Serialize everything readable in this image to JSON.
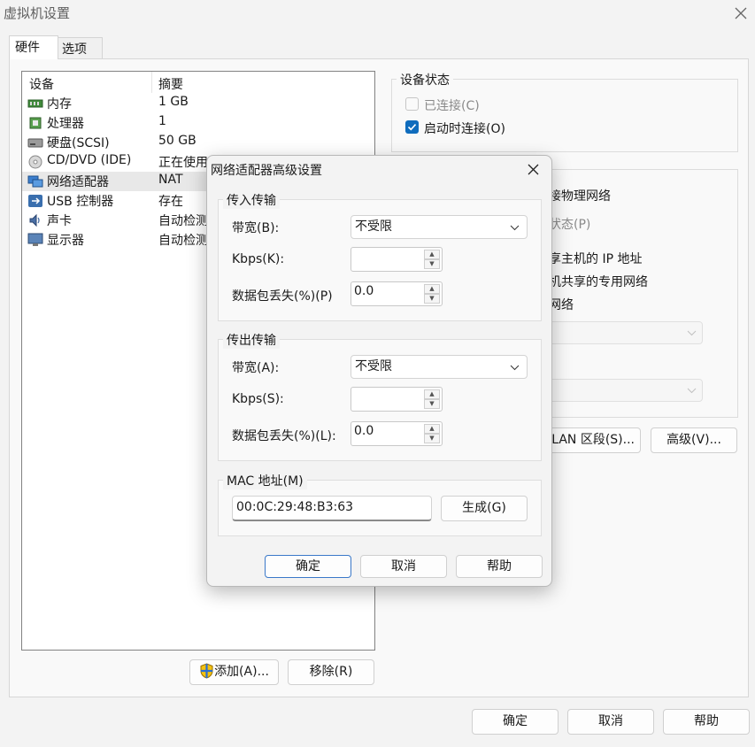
{
  "window": {
    "title": "虚拟机设置"
  },
  "tabs": [
    {
      "label": "硬件"
    },
    {
      "label": "选项"
    }
  ],
  "device_list": {
    "headers": {
      "device": "设备",
      "summary": "摘要"
    },
    "rows": [
      {
        "name": "内存",
        "summary": "1 GB",
        "icon": "memory-icon"
      },
      {
        "name": "处理器",
        "summary": "1",
        "icon": "cpu-icon"
      },
      {
        "name": "硬盘(SCSI)",
        "summary": "50 GB",
        "icon": "hard-disk-icon"
      },
      {
        "name": "CD/DVD (IDE)",
        "summary": "正在使用",
        "icon": "cd-dvd-icon"
      },
      {
        "name": "网络适配器",
        "summary": "NAT",
        "icon": "network-adapter-icon"
      },
      {
        "name": "USB 控制器",
        "summary": "存在",
        "icon": "usb-icon"
      },
      {
        "name": "声卡",
        "summary": "自动检测",
        "icon": "sound-icon"
      },
      {
        "name": "显示器",
        "summary": "自动检测",
        "icon": "monitor-icon"
      }
    ]
  },
  "device_buttons": {
    "add": "添加(A)...",
    "remove": "移除(R)"
  },
  "device_status": {
    "title": "设备状态",
    "connected": "已连接(C)",
    "connect_on_power": "启动时连接(O)"
  },
  "network_partial": {
    "bridged": "接物理网络",
    "replicate": "状态(P)",
    "nat": "享主机的 IP 地址",
    "host_only": "机共享的专用网络",
    "custom": "网络",
    "lan_segment_btn": "LAN 区段(S)...",
    "advanced_btn": "高级(V)..."
  },
  "bottom_buttons": {
    "ok": "确定",
    "cancel": "取消",
    "help": "帮助"
  },
  "dialog": {
    "title": "网络适配器高级设置",
    "incoming": {
      "title": "传入传输",
      "bandwidth_label": "带宽(B):",
      "bandwidth_value": "不受限",
      "kbps_label": "Kbps(K):",
      "kbps_value": "",
      "loss_label": "数据包丢失(%)(P)",
      "loss_value": "0.0"
    },
    "outgoing": {
      "title": "传出传输",
      "bandwidth_label": "带宽(A):",
      "bandwidth_value": "不受限",
      "kbps_label": "Kbps(S):",
      "kbps_value": "",
      "loss_label": "数据包丢失(%)(L):",
      "loss_value": "0.0"
    },
    "mac": {
      "title": "MAC 地址(M)",
      "value": "00:0C:29:48:B3:63",
      "generate_btn": "生成(G)"
    },
    "buttons": {
      "ok": "确定",
      "cancel": "取消",
      "help": "帮助"
    }
  },
  "colors": {
    "accent": "#0f6cbd",
    "selected_row": "#e8e8e8"
  }
}
